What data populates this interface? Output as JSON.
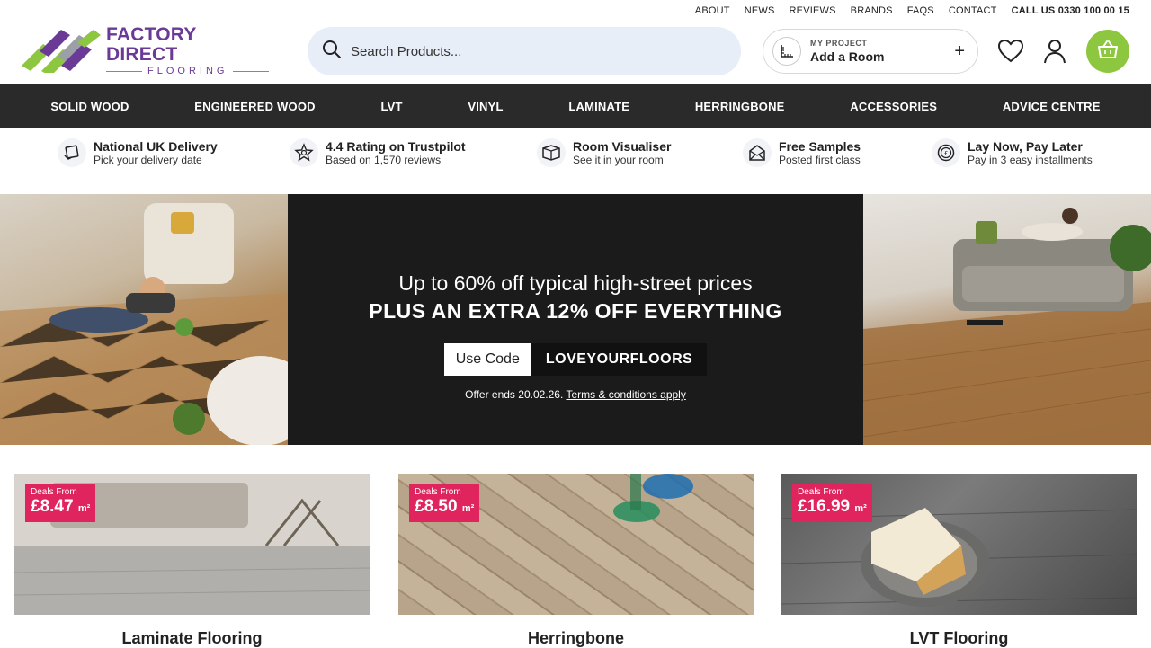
{
  "utility": {
    "links": [
      "ABOUT",
      "NEWS",
      "REVIEWS",
      "BRANDS",
      "FAQS",
      "CONTACT"
    ],
    "call": "CALL US 0330 100 00 15"
  },
  "logo": {
    "line1": "FACTORY DIRECT",
    "line2": "FLOORING"
  },
  "search": {
    "placeholder": "Search Products..."
  },
  "project": {
    "kicker": "MY PROJECT",
    "label": "Add a Room"
  },
  "nav": [
    "SOLID WOOD",
    "ENGINEERED WOOD",
    "LVT",
    "VINYL",
    "LAMINATE",
    "HERRINGBONE",
    "ACCESSORIES",
    "ADVICE CENTRE"
  ],
  "usps": [
    {
      "title": "National UK Delivery",
      "sub": "Pick your delivery date",
      "icon": "delivery-icon"
    },
    {
      "title": "4.4 Rating on Trustpilot",
      "sub": "Based on 1,570 reviews",
      "icon": "star-rating-icon"
    },
    {
      "title": "Room Visualiser",
      "sub": "See it in your room",
      "icon": "room-icon"
    },
    {
      "title": "Free Samples",
      "sub": "Posted first class",
      "icon": "envelope-icon"
    },
    {
      "title": "Lay Now, Pay Later",
      "sub": "Pay in 3 easy installments",
      "icon": "pay-later-icon"
    }
  ],
  "hero": {
    "line1": "Up to 60% off typical high-street prices",
    "line2": "PLUS AN EXTRA 12% OFF EVERYTHING",
    "code_label": "Use Code",
    "code": "LOVEYOURFLOORS",
    "offer_text": "Offer ends 20.02.26.",
    "terms": "Terms & conditions apply"
  },
  "categories": [
    {
      "name": "Laminate Flooring",
      "deal_label": "Deals From",
      "price": "£8.47",
      "unit": "m²"
    },
    {
      "name": "Herringbone",
      "deal_label": "Deals From",
      "price": "£8.50",
      "unit": "m²"
    },
    {
      "name": "LVT Flooring",
      "deal_label": "Deals From",
      "price": "£16.99",
      "unit": "m²"
    }
  ],
  "colors": {
    "brand_purple": "#6b3a96",
    "brand_green": "#8dc63f",
    "nav_bg": "#2a2a2a",
    "deal_pink": "#e0245e"
  }
}
